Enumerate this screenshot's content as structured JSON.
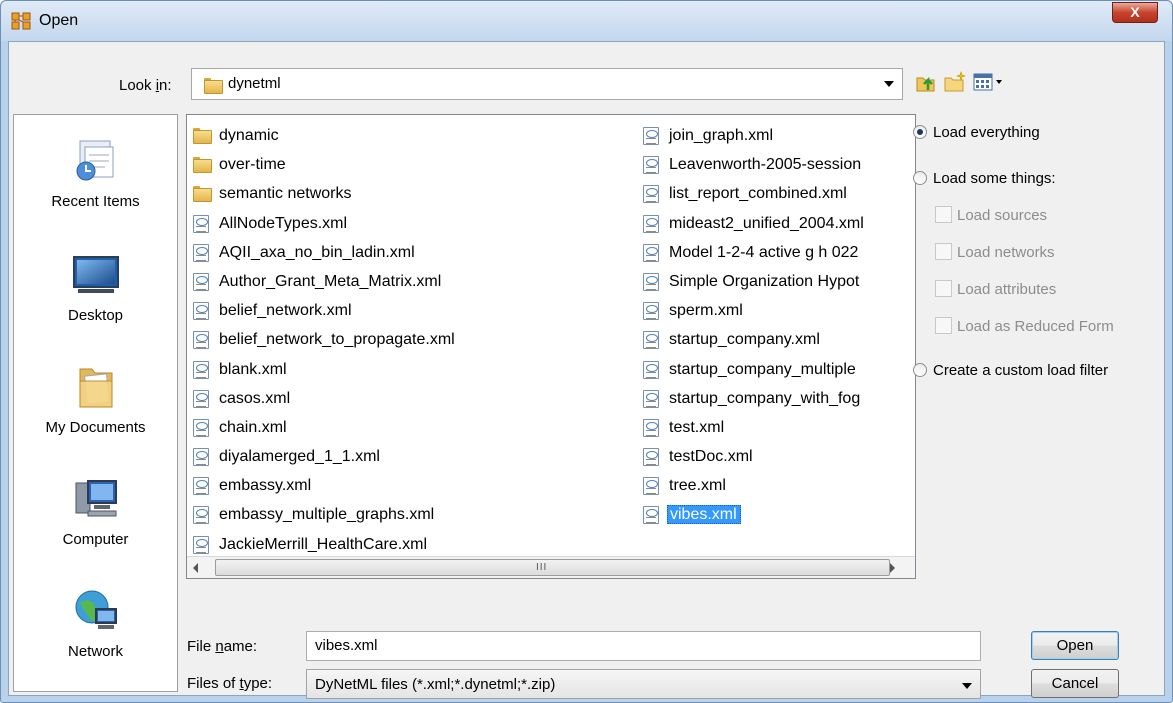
{
  "window": {
    "title": "Open",
    "app_icon": "ora-app-icon",
    "close_label": "X"
  },
  "lookin": {
    "label_pre": "Look ",
    "label_accel": "i",
    "label_post": "n:",
    "value": "dynetml"
  },
  "toolbar": {
    "icons": [
      "up-one-level-icon",
      "new-folder-icon",
      "view-menu-icon"
    ]
  },
  "places": [
    {
      "label": "Recent Items",
      "icon": "recent-items-icon"
    },
    {
      "label": "Desktop",
      "icon": "desktop-icon"
    },
    {
      "label": "My Documents",
      "icon": "my-documents-icon"
    },
    {
      "label": "Computer",
      "icon": "computer-icon"
    },
    {
      "label": "Network",
      "icon": "network-icon"
    }
  ],
  "files": {
    "col1": [
      {
        "name": "dynamic",
        "type": "folder"
      },
      {
        "name": "over-time",
        "type": "folder"
      },
      {
        "name": "semantic networks",
        "type": "folder"
      },
      {
        "name": "AllNodeTypes.xml",
        "type": "xml"
      },
      {
        "name": "AQII_axa_no_bin_ladin.xml",
        "type": "xml"
      },
      {
        "name": "Author_Grant_Meta_Matrix.xml",
        "type": "xml"
      },
      {
        "name": "belief_network.xml",
        "type": "xml"
      },
      {
        "name": "belief_network_to_propagate.xml",
        "type": "xml"
      },
      {
        "name": "blank.xml",
        "type": "xml"
      },
      {
        "name": "casos.xml",
        "type": "xml"
      },
      {
        "name": "chain.xml",
        "type": "xml"
      },
      {
        "name": "diyalamerged_1_1.xml",
        "type": "xml"
      },
      {
        "name": "embassy.xml",
        "type": "xml"
      },
      {
        "name": "embassy_multiple_graphs.xml",
        "type": "xml"
      },
      {
        "name": "JackieMerrill_HealthCare.xml",
        "type": "xml"
      }
    ],
    "col2": [
      {
        "name": "join_graph.xml",
        "type": "xml"
      },
      {
        "name": "Leavenworth-2005-session",
        "type": "xml"
      },
      {
        "name": "list_report_combined.xml",
        "type": "xml"
      },
      {
        "name": "mideast2_unified_2004.xml",
        "type": "xml"
      },
      {
        "name": "Model 1-2-4 active g h  022",
        "type": "xml"
      },
      {
        "name": "Simple Organization Hypot",
        "type": "xml"
      },
      {
        "name": "sperm.xml",
        "type": "xml"
      },
      {
        "name": "startup_company.xml",
        "type": "xml"
      },
      {
        "name": "startup_company_multiple",
        "type": "xml"
      },
      {
        "name": "startup_company_with_fog",
        "type": "xml"
      },
      {
        "name": "test.xml",
        "type": "xml"
      },
      {
        "name": "testDoc.xml",
        "type": "xml"
      },
      {
        "name": "tree.xml",
        "type": "xml"
      },
      {
        "name": "vibes.xml",
        "type": "xml",
        "selected": true
      }
    ],
    "scroll_grip": "III"
  },
  "options": {
    "load_everything": "Load everything",
    "load_some": "Load some things:",
    "load_sources": "Load sources",
    "load_networks": "Load networks",
    "load_attributes": "Load attributes",
    "load_reduced": "Load as Reduced Form",
    "custom_filter": "Create a custom load filter",
    "selected": "load_everything"
  },
  "filename": {
    "label_pre": "File ",
    "label_accel": "n",
    "label_post": "ame:",
    "value": "vibes.xml"
  },
  "filetype": {
    "label_pre": "Files of ",
    "label_accel": "t",
    "label_post": "ype:",
    "value": "DyNetML files (*.xml;*.dynetml;*.zip)"
  },
  "buttons": {
    "open": "Open",
    "cancel": "Cancel"
  }
}
